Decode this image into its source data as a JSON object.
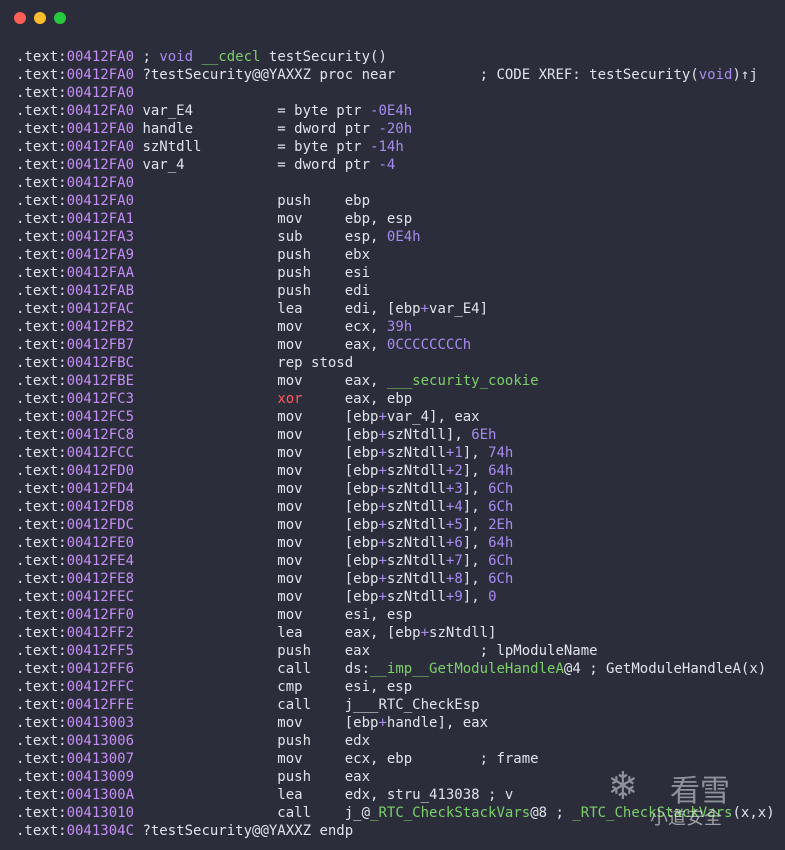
{
  "window": {
    "buttons": [
      "close",
      "minimize",
      "zoom"
    ]
  },
  "colors": {
    "background": "#2b2e3a",
    "address": "#c58ef7",
    "number": "#a78bf0",
    "identifier_green": "#7ccf6a",
    "highlight_red": "#ff5a5a"
  },
  "lines": [
    {
      "addr": "00412FA0",
      "rest": " ; void __cdecl testSecurity()"
    },
    {
      "addr": "00412FA0",
      "rest": " ?testSecurity@@YAXXZ proc near          ; CODE XREF: testSecurity(void)↑j"
    },
    {
      "addr": "00412FA0",
      "rest": ""
    },
    {
      "addr": "00412FA0",
      "rest": " var_E4          = byte ptr -0E4h"
    },
    {
      "addr": "00412FA0",
      "rest": " handle          = dword ptr -20h"
    },
    {
      "addr": "00412FA0",
      "rest": " szNtdll         = byte ptr -14h"
    },
    {
      "addr": "00412FA0",
      "rest": " var_4           = dword ptr -4"
    },
    {
      "addr": "00412FA0",
      "rest": ""
    },
    {
      "addr": "00412FA0",
      "rest": "                 push    ebp"
    },
    {
      "addr": "00412FA1",
      "rest": "                 mov     ebp, esp"
    },
    {
      "addr": "00412FA3",
      "rest": "                 sub     esp, 0E4h"
    },
    {
      "addr": "00412FA9",
      "rest": "                 push    ebx"
    },
    {
      "addr": "00412FAA",
      "rest": "                 push    esi"
    },
    {
      "addr": "00412FAB",
      "rest": "                 push    edi"
    },
    {
      "addr": "00412FAC",
      "rest": "                 lea     edi, [ebp+var_E4]"
    },
    {
      "addr": "00412FB2",
      "rest": "                 mov     ecx, 39h"
    },
    {
      "addr": "00412FB7",
      "rest": "                 mov     eax, 0CCCCCCCCh"
    },
    {
      "addr": "00412FBC",
      "rest": "                 rep stosd"
    },
    {
      "addr": "00412FBE",
      "rest": "                 mov     eax, ___security_cookie"
    },
    {
      "addr": "00412FC3",
      "rest": "                 xor     eax, ebp"
    },
    {
      "addr": "00412FC5",
      "rest": "                 mov     [ebp+var_4], eax"
    },
    {
      "addr": "00412FC8",
      "rest": "                 mov     [ebp+szNtdll], 6Eh"
    },
    {
      "addr": "00412FCC",
      "rest": "                 mov     [ebp+szNtdll+1], 74h"
    },
    {
      "addr": "00412FD0",
      "rest": "                 mov     [ebp+szNtdll+2], 64h"
    },
    {
      "addr": "00412FD4",
      "rest": "                 mov     [ebp+szNtdll+3], 6Ch"
    },
    {
      "addr": "00412FD8",
      "rest": "                 mov     [ebp+szNtdll+4], 6Ch"
    },
    {
      "addr": "00412FDC",
      "rest": "                 mov     [ebp+szNtdll+5], 2Eh"
    },
    {
      "addr": "00412FE0",
      "rest": "                 mov     [ebp+szNtdll+6], 64h"
    },
    {
      "addr": "00412FE4",
      "rest": "                 mov     [ebp+szNtdll+7], 6Ch"
    },
    {
      "addr": "00412FE8",
      "rest": "                 mov     [ebp+szNtdll+8], 6Ch"
    },
    {
      "addr": "00412FEC",
      "rest": "                 mov     [ebp+szNtdll+9], 0"
    },
    {
      "addr": "00412FF0",
      "rest": "                 mov     esi, esp"
    },
    {
      "addr": "00412FF2",
      "rest": "                 lea     eax, [ebp+szNtdll]"
    },
    {
      "addr": "00412FF5",
      "rest": "                 push    eax             ; lpModuleName"
    },
    {
      "addr": "00412FF6",
      "rest": "                 call    ds:__imp__GetModuleHandleA@4 ; GetModuleHandleA(x)"
    },
    {
      "addr": "00412FFC",
      "rest": "                 cmp     esi, esp"
    },
    {
      "addr": "00412FFE",
      "rest": "                 call    j___RTC_CheckEsp"
    },
    {
      "addr": "00413003",
      "rest": "                 mov     [ebp+handle], eax"
    },
    {
      "addr": "00413006",
      "rest": "                 push    edx"
    },
    {
      "addr": "00413007",
      "rest": "                 mov     ecx, ebp        ; frame"
    },
    {
      "addr": "00413009",
      "rest": "                 push    eax"
    },
    {
      "addr": "0041300A",
      "rest": "                 lea     edx, stru_413038 ; v"
    },
    {
      "addr": "00413010",
      "rest": "                 call    j_@_RTC_CheckStackVars@8 ; _RTC_CheckStackVars(x,x)"
    },
    {
      "addr": "0041304C",
      "rest": " ?testSecurity@@YAXXZ endp"
    }
  ],
  "segment_prefix": ".text:",
  "watermark": {
    "brand": "看雪",
    "badge": "小道安全",
    "icon": "snowflake-icon"
  }
}
